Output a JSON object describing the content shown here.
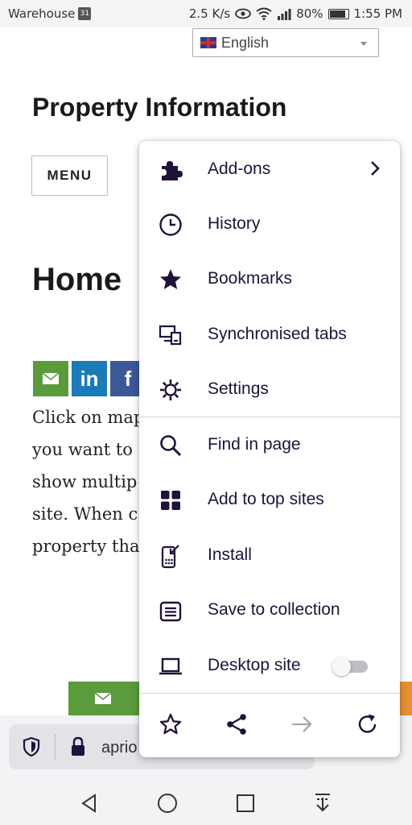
{
  "status_bar": {
    "app": "Warehouse",
    "calendar_day": "31",
    "speed": "2.5 K/s",
    "battery": "80%",
    "time": "1:55 PM"
  },
  "page": {
    "language": "English",
    "title": "Property Information",
    "menu_label": "MENU",
    "heading": "Home",
    "share_labels": {
      "linkedin": "in",
      "facebook": "f"
    },
    "body_lines": [
      "Click on map",
      "you want to",
      "show multip",
      "site. When c",
      "property tha"
    ]
  },
  "popup_menu": {
    "items": [
      {
        "label": "Add-ons",
        "icon": "puzzle-icon"
      },
      {
        "label": "History",
        "icon": "clock-icon"
      },
      {
        "label": "Bookmarks",
        "icon": "star-icon"
      },
      {
        "label": "Synchronised tabs",
        "icon": "devices-icon"
      },
      {
        "label": "Settings",
        "icon": "gear-icon"
      },
      {
        "label": "Find in page",
        "icon": "search-icon"
      },
      {
        "label": "Add to top sites",
        "icon": "grid-icon"
      },
      {
        "label": "Install",
        "icon": "phone-install-icon"
      },
      {
        "label": "Save to collection",
        "icon": "collection-icon"
      },
      {
        "label": "Desktop site",
        "icon": "laptop-icon"
      }
    ],
    "desktop_site_enabled": false,
    "bottom_actions": [
      "star-outline-icon",
      "share-icon",
      "forward-icon",
      "reload-icon"
    ]
  },
  "toolbar": {
    "url": "aprio"
  },
  "colors": {
    "menu_text": "#20123a",
    "email_green": "#5a9b3c",
    "linkedin_blue": "#1a7bb9",
    "facebook_blue": "#3b5998",
    "orange": "#e8902f"
  }
}
